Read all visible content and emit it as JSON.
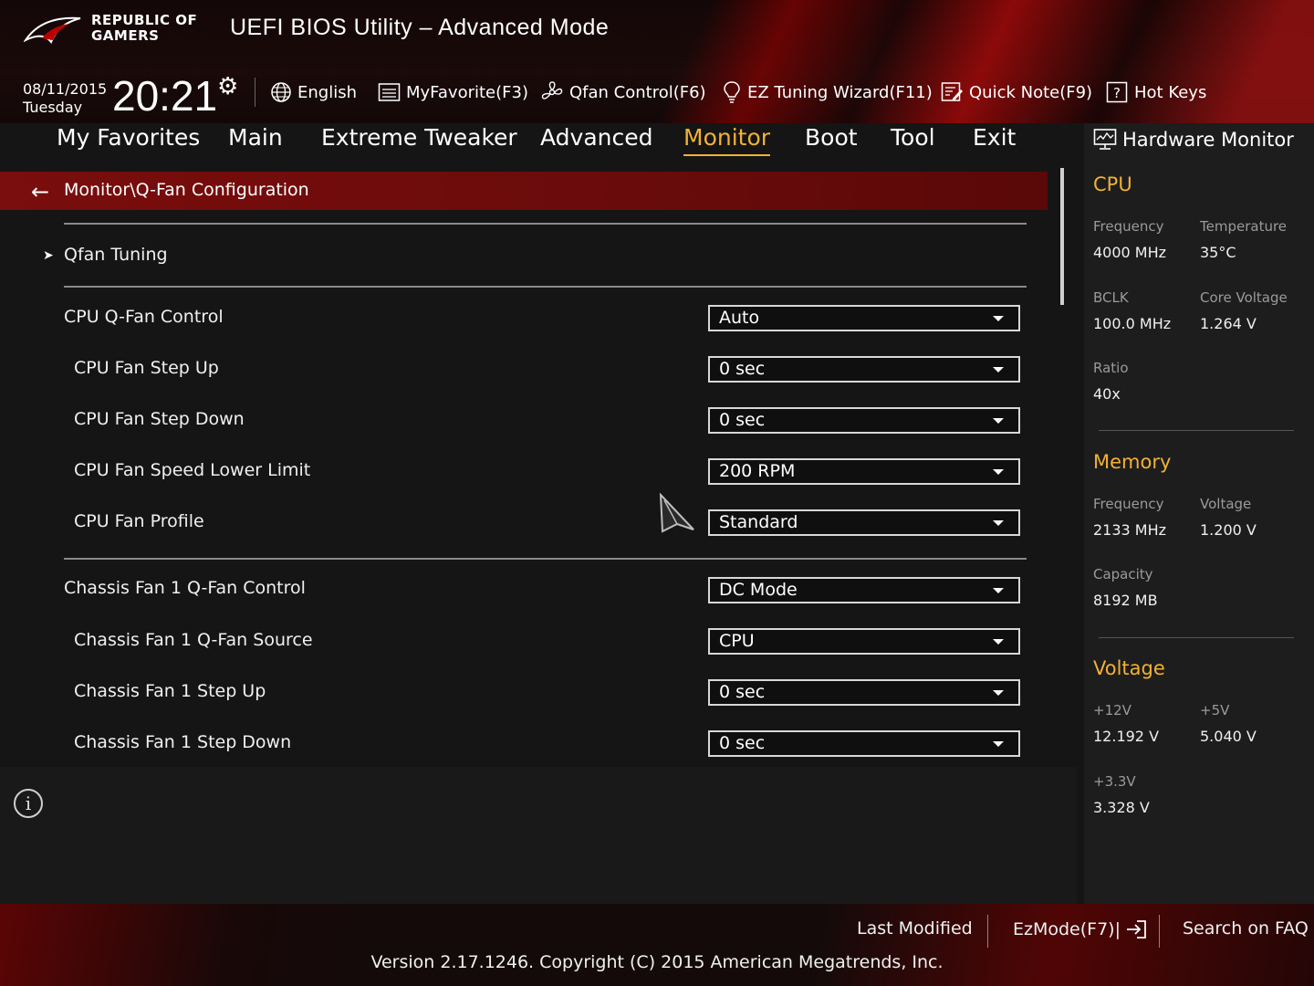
{
  "header": {
    "logo_line1": "REPUBLIC OF",
    "logo_line2": "GAMERS",
    "title": "UEFI BIOS Utility – Advanced Mode",
    "date": "08/11/2015",
    "day": "Tuesday",
    "time": "20:21",
    "language": "English",
    "myfavorite": "MyFavorite(F3)",
    "qfan": "Qfan Control(F6)",
    "ez_tuning": "EZ Tuning Wizard(F11)",
    "quick_note": "Quick Note(F9)",
    "hot_keys": "Hot Keys"
  },
  "menu": {
    "items": [
      "My Favorites",
      "Main",
      "Extreme Tweaker",
      "Advanced",
      "Monitor",
      "Boot",
      "Tool",
      "Exit"
    ],
    "active": "Monitor"
  },
  "breadcrumb": "Monitor\\Q-Fan Configuration",
  "settings": {
    "qfan_tuning": "Qfan Tuning",
    "rows": [
      {
        "label": "CPU Q-Fan Control",
        "value": "Auto"
      },
      {
        "label": "CPU Fan Step Up",
        "value": "0 sec"
      },
      {
        "label": "CPU Fan Step Down",
        "value": "0 sec"
      },
      {
        "label": "CPU Fan Speed Lower Limit",
        "value": "200 RPM"
      },
      {
        "label": "CPU Fan Profile",
        "value": "Standard"
      },
      {
        "label": "Chassis Fan 1 Q-Fan Control",
        "value": "DC Mode"
      },
      {
        "label": "Chassis Fan 1 Q-Fan Source",
        "value": "CPU"
      },
      {
        "label": "Chassis Fan 1 Step Up",
        "value": "0 sec"
      },
      {
        "label": "Chassis Fan 1 Step Down",
        "value": "0 sec"
      }
    ]
  },
  "hardware_monitor": {
    "title": "Hardware Monitor",
    "cpu": {
      "heading": "CPU",
      "frequency_label": "Frequency",
      "frequency": "4000 MHz",
      "temperature_label": "Temperature",
      "temperature": "35°C",
      "bclk_label": "BCLK",
      "bclk": "100.0 MHz",
      "core_voltage_label": "Core Voltage",
      "core_voltage": "1.264 V",
      "ratio_label": "Ratio",
      "ratio": "40x"
    },
    "memory": {
      "heading": "Memory",
      "frequency_label": "Frequency",
      "frequency": "2133 MHz",
      "voltage_label": "Voltage",
      "voltage": "1.200 V",
      "capacity_label": "Capacity",
      "capacity": "8192 MB"
    },
    "voltage": {
      "heading": "Voltage",
      "v12_label": "+12V",
      "v12": "12.192 V",
      "v5_label": "+5V",
      "v5": "5.040 V",
      "v33_label": "+3.3V",
      "v33": "3.328 V"
    }
  },
  "footer": {
    "last_modified": "Last Modified",
    "ezmode": "EzMode(F7)|",
    "search_faq": "Search on FAQ",
    "version": "Version 2.17.1246. Copyright (C) 2015 American Megatrends, Inc."
  },
  "colors": {
    "accent": "#f2b134",
    "breadcrumb_bar": "#7a0d0d",
    "background": "#151515"
  },
  "icons": {
    "settings": "gear-icon",
    "language": "globe-icon",
    "myfavorite": "list-icon",
    "qfan": "fan-icon",
    "ez_tuning": "bulb-icon",
    "quick_note": "note-icon",
    "hot_keys": "question-icon",
    "hardware_monitor": "monitor-icon",
    "back": "back-arrow-icon",
    "info": "info-icon",
    "ezmode": "exit-icon"
  }
}
